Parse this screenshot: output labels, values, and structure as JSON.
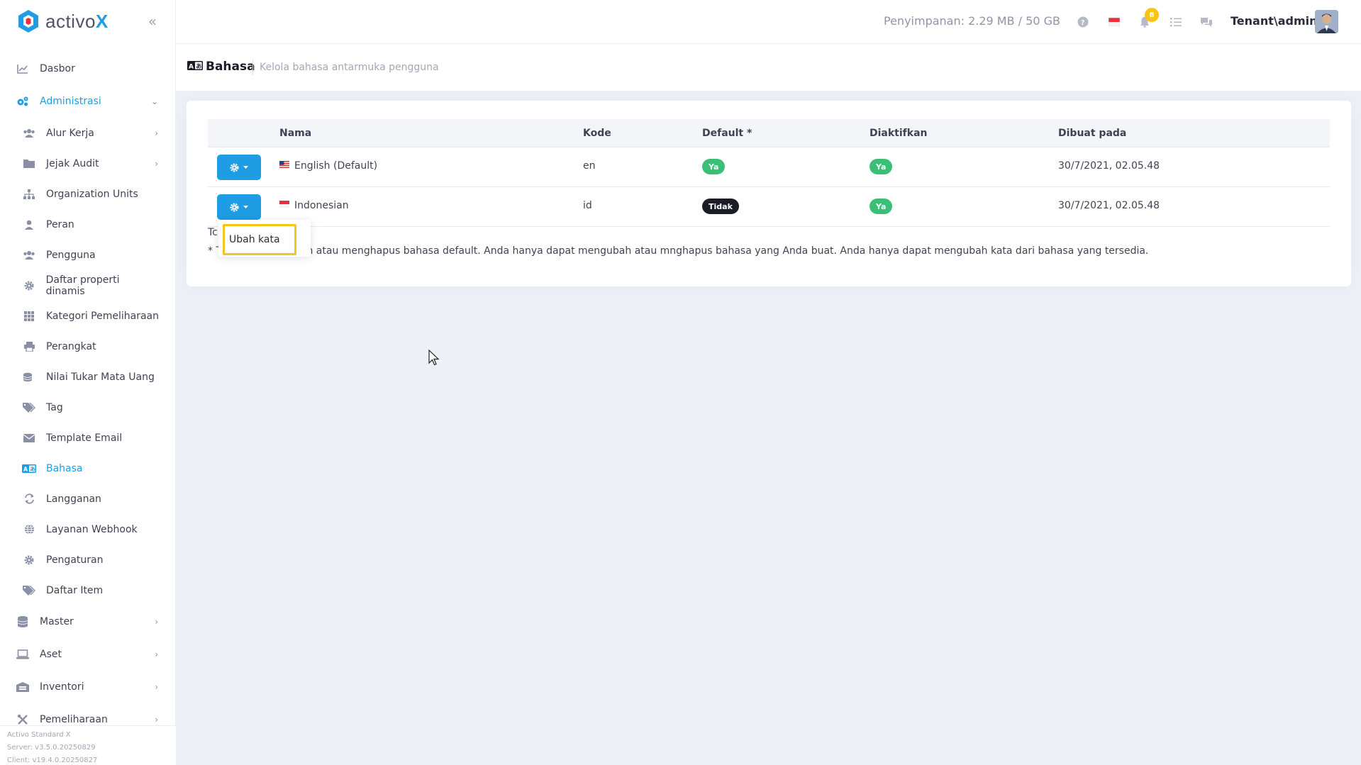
{
  "brand": {
    "name": "activo",
    "accent_letter": "X"
  },
  "header": {
    "storage": "Penyimpanan: 2.29 MB / 50 GB",
    "notification_count": "8",
    "user": "Tenant\\admin"
  },
  "subheader": {
    "title": "Bahasa",
    "description": "Kelola bahasa antarmuka pengguna"
  },
  "sidebar": {
    "top": [
      {
        "label": "Dasbor"
      },
      {
        "label": "Administrasi"
      }
    ],
    "admin_items": [
      {
        "label": "Alur Kerja"
      },
      {
        "label": "Jejak Audit"
      },
      {
        "label": "Organization Units"
      },
      {
        "label": "Peran"
      },
      {
        "label": "Pengguna"
      },
      {
        "label": "Daftar properti dinamis"
      },
      {
        "label": "Kategori Pemeliharaan"
      },
      {
        "label": "Perangkat"
      },
      {
        "label": "Nilai Tukar Mata Uang"
      },
      {
        "label": "Tag"
      },
      {
        "label": "Template Email"
      },
      {
        "label": "Bahasa"
      },
      {
        "label": "Langganan"
      },
      {
        "label": "Layanan Webhook"
      },
      {
        "label": "Pengaturan"
      },
      {
        "label": "Daftar Item"
      }
    ],
    "bottom": [
      {
        "label": "Master"
      },
      {
        "label": "Aset"
      },
      {
        "label": "Inventori"
      },
      {
        "label": "Pemeliharaan"
      }
    ],
    "footer": {
      "product": "Activo Standard X",
      "server": "Server: v3.5.0.20250829",
      "client": "Client: v19.4.0.20250827"
    }
  },
  "table": {
    "headers": [
      "Nama",
      "Kode",
      "Default *",
      "Diaktifkan",
      "Dibuat pada"
    ],
    "rows": [
      {
        "name": "English (Default)",
        "code": "en",
        "default": "Ya",
        "enabled": "Ya",
        "created": "30/7/2021, 02.05.48"
      },
      {
        "name": "Indonesian",
        "code": "id",
        "default": "Tidak",
        "enabled": "Ya",
        "created": "30/7/2021, 02.05.48"
      }
    ]
  },
  "notes": {
    "line1_prefix": "Tc",
    "line2_prefix": "* T",
    "line2": "bah atau menghapus bahasa default. Anda hanya dapat mengubah atau mnghapus bahasa yang Anda buat. Anda hanya dapat mengubah kata dari bahasa yang tersedia."
  },
  "dropdown": {
    "item": "Ubah kata"
  },
  "colors": {
    "accent": "#1e9ce4",
    "success": "#3bbf76",
    "dark": "#1b1c28",
    "highlight": "#f6c51a"
  }
}
